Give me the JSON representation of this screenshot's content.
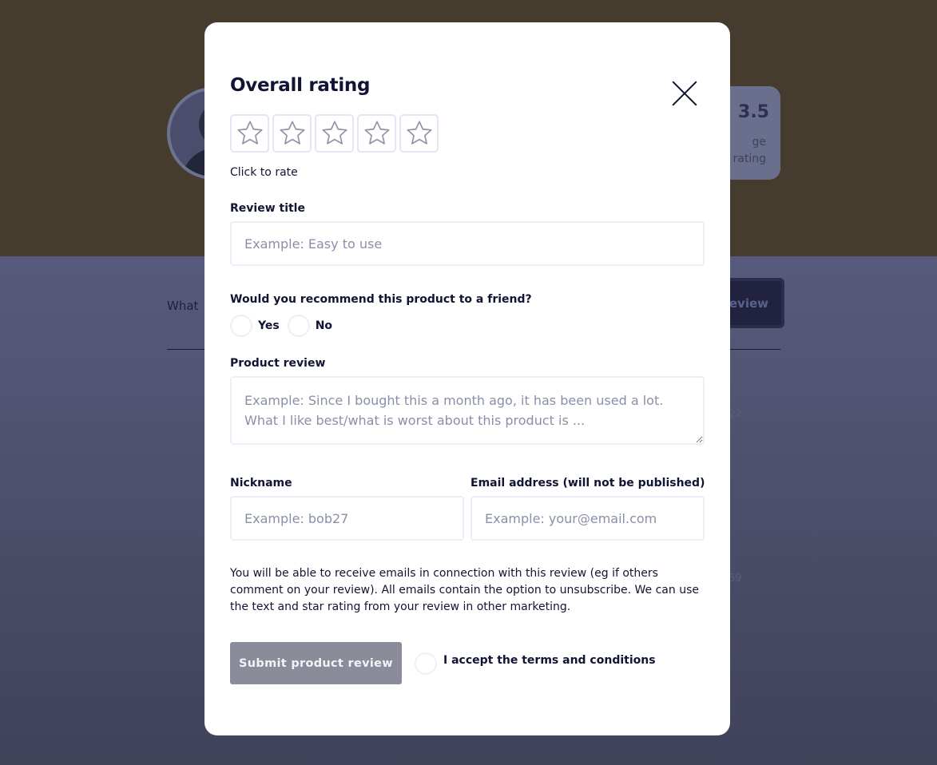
{
  "background": {
    "average_rating": "3.5",
    "average_label_line1": "ge",
    "average_label_line2": "rating",
    "what_text": "What",
    "write_review_button": "eview",
    "dates": [
      "22",
      "59"
    ]
  },
  "modal": {
    "title": "Overall rating",
    "star_count": 5,
    "click_to_rate": "Click to rate",
    "review_title": {
      "label": "Review title",
      "placeholder": "Example: Easy to use",
      "value": ""
    },
    "recommend": {
      "label": "Would you recommend this product to a friend?",
      "yes": "Yes",
      "no": "No"
    },
    "product_review": {
      "label": "Product review",
      "placeholder": "Example: Since I bought this a month ago, it has been used a lot. What I like best/what is worst about this product is ..."
    },
    "nickname": {
      "label": "Nickname",
      "placeholder": "Example: bob27"
    },
    "email": {
      "label": "Email address (will not be published)",
      "placeholder": "Example: your@email.com"
    },
    "disclaimer": "You will be able to receive emails in connection with this review (eg if others comment on your review). All emails contain the option to unsubscribe. We can use the text and star rating from your review in other marketing.",
    "submit_label": "Submit product review",
    "terms_label": "I accept the terms and conditions"
  },
  "colors": {
    "overlay_top": "#453c2e",
    "overlay_bottom": "#4d506c",
    "text_primary": "#111433",
    "submit_disabled": "#8b8c99",
    "field_border": "#eceef8"
  }
}
